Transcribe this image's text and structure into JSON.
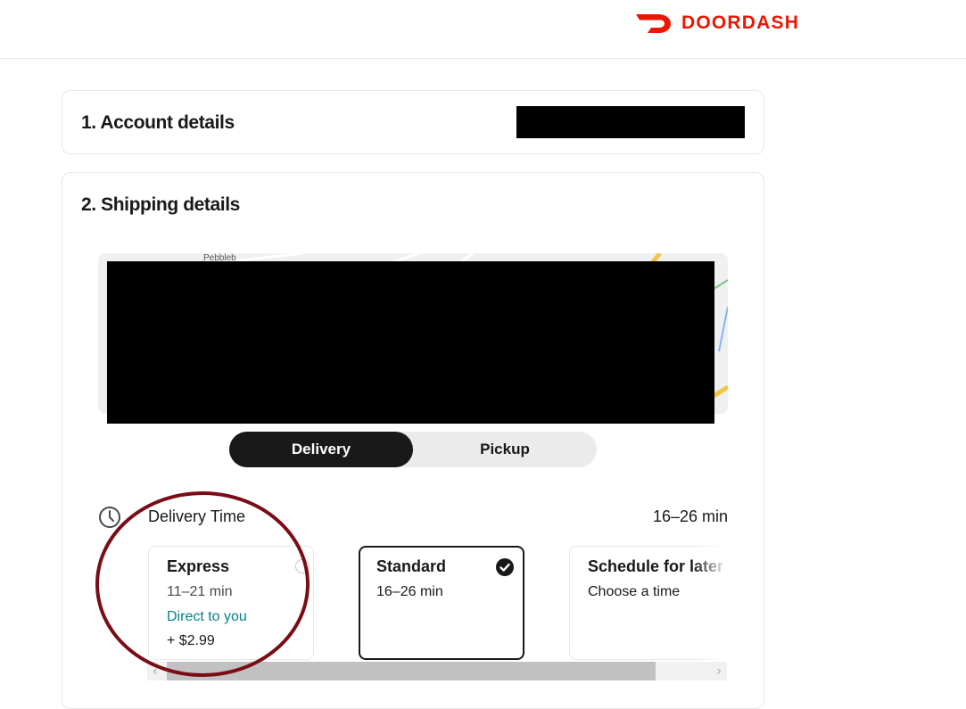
{
  "brand": {
    "name": "DOORDASH",
    "color": "#eb1700",
    "icon": "doordash-dash-logo-icon"
  },
  "account_section": {
    "title": "1. Account details",
    "value_redacted": true
  },
  "shipping_section": {
    "title": "2. Shipping details",
    "map": {
      "visible_labels": [
        "Pebbleb"
      ],
      "redacted": true
    },
    "fulfillment_toggle": {
      "options": [
        "Delivery",
        "Pickup"
      ],
      "selected": "Delivery"
    },
    "delivery_time": {
      "icon": "clock-icon",
      "label": "Delivery Time",
      "value": "16–26 min"
    },
    "delivery_options": [
      {
        "title": "Express",
        "time": "11–21 min",
        "subtitle": "Direct to you",
        "fee": "+ $2.99",
        "selected": false
      },
      {
        "title": "Standard",
        "time": "16–26 min",
        "selected": true
      },
      {
        "title": "Schedule for later",
        "time": "Choose a time",
        "selected": false
      }
    ]
  },
  "colors": {
    "brand_red": "#eb1700",
    "dark": "#191919",
    "teal": "#00838a",
    "annotation": "#7a0c16"
  }
}
